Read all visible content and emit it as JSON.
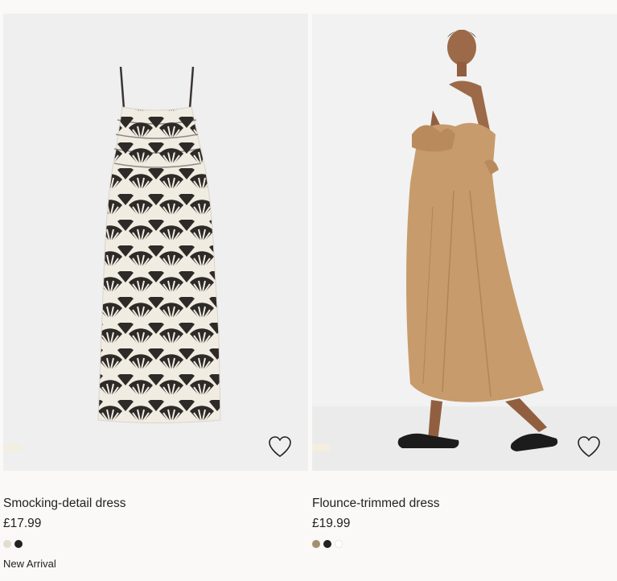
{
  "products": [
    {
      "title": "Smocking-detail dress",
      "price": "£17.99",
      "swatches": [
        "#e3ddd0",
        "#222222"
      ],
      "badge": "New Arrival",
      "favourite_icon": "heart-outline-icon"
    },
    {
      "title": "Flounce-trimmed dress",
      "price": "£19.99",
      "swatches": [
        "#a38f6f",
        "#222222",
        "#ffffff"
      ],
      "favourite_icon": "heart-outline-icon"
    }
  ]
}
